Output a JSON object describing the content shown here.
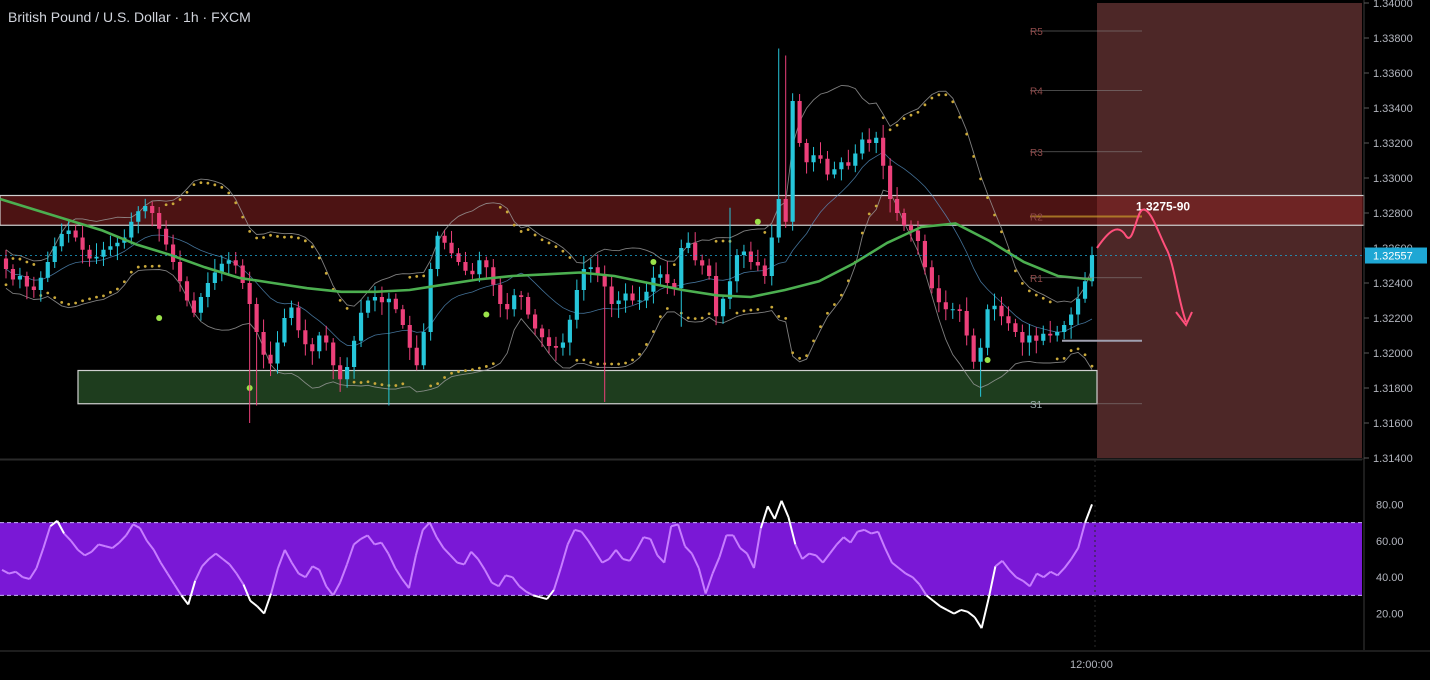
{
  "header": {
    "title": "British Pound / U.S. Dollar · 1h · FXCM"
  },
  "colors": {
    "background": "#000000",
    "candle_up": "#26c6da",
    "candle_down": "#ec407a",
    "sma": "#4caf50",
    "psar": "#c9a83a",
    "bands": "#9e9e9e",
    "resistance_zone": "#8b2323",
    "support_zone": "#2e5e2e",
    "forecast_shade": "#5a2e2e",
    "forecast_arrow": "#ff4f7b",
    "rsi_line": "#b45cff",
    "rsi_band": "#7a18d6",
    "price_tag": "#1ea7d4"
  },
  "chart_data": [
    {
      "type": "candlestick",
      "title": "British Pound / U.S. Dollar · 1h · FXCM",
      "ylim": [
        1.314,
        1.34
      ],
      "y_ticks": [
        "1.31400",
        "1.31600",
        "1.31800",
        "1.32000",
        "1.32200",
        "1.32400",
        "1.32557",
        "1.32600",
        "1.32800",
        "1.33000",
        "1.33200",
        "1.33400",
        "1.33600",
        "1.33800",
        "1.34000"
      ],
      "x_ticks": [
        "12:00:00"
      ],
      "last_price": "1.32557",
      "zones": [
        {
          "name": "resistance",
          "from": 1.3273,
          "to": 1.329
        },
        {
          "name": "support",
          "from": 1.3171,
          "to": 1.319
        }
      ],
      "pivots": [
        {
          "label": "R5",
          "value": 1.3384
        },
        {
          "label": "R4",
          "value": 1.335
        },
        {
          "label": "R3",
          "value": 1.3315
        },
        {
          "label": "R2",
          "value": 1.3278
        },
        {
          "label": "R1",
          "value": 1.3243
        },
        {
          "label": "S1",
          "value": 1.3171
        }
      ],
      "annotation": "1.3275-90",
      "series": [
        {
          "name": "close",
          "values": [
            1.3248,
            1.3242,
            1.3244,
            1.3238,
            1.3236,
            1.3243,
            1.3252,
            1.3261,
            1.3268,
            1.327,
            1.3266,
            1.3259,
            1.3254,
            1.3255,
            1.3259,
            1.3261,
            1.3263,
            1.3266,
            1.3275,
            1.3281,
            1.3284,
            1.328,
            1.3271,
            1.3262,
            1.3252,
            1.3241,
            1.323,
            1.3223,
            1.3232,
            1.324,
            1.3246,
            1.3251,
            1.3253,
            1.325,
            1.324,
            1.3228,
            1.3212,
            1.3199,
            1.3194,
            1.3206,
            1.322,
            1.3226,
            1.3213,
            1.3205,
            1.3201,
            1.321,
            1.3206,
            1.3193,
            1.3185,
            1.3192,
            1.3207,
            1.3223,
            1.323,
            1.3232,
            1.3229,
            1.3231,
            1.3225,
            1.3216,
            1.3203,
            1.3193,
            1.3212,
            1.3248,
            1.3267,
            1.3263,
            1.3257,
            1.3252,
            1.3247,
            1.3245,
            1.3253,
            1.3249,
            1.3239,
            1.3228,
            1.3225,
            1.3233,
            1.3232,
            1.3222,
            1.3214,
            1.3209,
            1.3204,
            1.3203,
            1.3206,
            1.3219,
            1.3236,
            1.3248,
            1.3249,
            1.3245,
            1.3238,
            1.3228,
            1.323,
            1.3234,
            1.323,
            1.323,
            1.3235,
            1.3243,
            1.3245,
            1.324,
            1.3237,
            1.326,
            1.3263,
            1.3253,
            1.325,
            1.3244,
            1.3221,
            1.3231,
            1.3241,
            1.3256,
            1.3258,
            1.3252,
            1.325,
            1.3244,
            1.3266,
            1.3288,
            1.3275,
            1.3344,
            1.332,
            1.3309,
            1.3313,
            1.3311,
            1.3302,
            1.3305,
            1.3309,
            1.3307,
            1.3314,
            1.3322,
            1.332,
            1.3323,
            1.3307,
            1.3288,
            1.328,
            1.3273,
            1.327,
            1.3264,
            1.3249,
            1.3237,
            1.3229,
            1.3225,
            1.3225,
            1.3224,
            1.321,
            1.3195,
            1.3203,
            1.3225,
            1.3227,
            1.3221,
            1.3217,
            1.3212,
            1.3206,
            1.321,
            1.3207,
            1.3211,
            1.321,
            1.3212,
            1.3216,
            1.3222,
            1.3231,
            1.3241,
            1.3256
          ]
        },
        {
          "name": "SMA",
          "values": [
            1.3288,
            1.3282,
            1.3276,
            1.327,
            1.3262,
            1.3256,
            1.3249,
            1.3243,
            1.324,
            1.3237,
            1.3235,
            1.3235,
            1.3236,
            1.3239,
            1.3242,
            1.3244,
            1.3245,
            1.3246,
            1.3244,
            1.324,
            1.3236,
            1.3233,
            1.3232,
            1.3236,
            1.3241,
            1.3251,
            1.3263,
            1.3272,
            1.3274,
            1.3264,
            1.3252,
            1.3244,
            1.3242
          ]
        },
        {
          "name": "RSI",
          "values": [
            44,
            42,
            43,
            40,
            39,
            45,
            56,
            68,
            71,
            64,
            60,
            55,
            52,
            54,
            58,
            57,
            56,
            59,
            63,
            69,
            67,
            60,
            55,
            48,
            42,
            36,
            30,
            25,
            38,
            46,
            50,
            53,
            50,
            47,
            42,
            36,
            27,
            24,
            20,
            31,
            45,
            55,
            48,
            42,
            40,
            46,
            44,
            35,
            30,
            37,
            47,
            58,
            61,
            63,
            58,
            59,
            53,
            45,
            39,
            34,
            52,
            66,
            70,
            62,
            56,
            52,
            48,
            47,
            54,
            50,
            44,
            37,
            35,
            41,
            40,
            35,
            32,
            30,
            29,
            28,
            33,
            45,
            58,
            66,
            65,
            60,
            54,
            48,
            50,
            55,
            50,
            49,
            55,
            62,
            61,
            52,
            48,
            68,
            69,
            57,
            53,
            45,
            31,
            42,
            51,
            63,
            63,
            56,
            53,
            45,
            67,
            79,
            72,
            82,
            73,
            58,
            50,
            53,
            52,
            48,
            53,
            58,
            62,
            59,
            65,
            66,
            64,
            65,
            56,
            48,
            45,
            42,
            40,
            36,
            30,
            27,
            24,
            22,
            20,
            22,
            21,
            18,
            12,
            28,
            46,
            49,
            44,
            40,
            38,
            35,
            42,
            40,
            43,
            41,
            45,
            50,
            56,
            70,
            80
          ]
        }
      ],
      "rsi_panel": {
        "title": "RSI",
        "ylim": [
          0,
          100
        ],
        "band": [
          30,
          70
        ],
        "y_ticks": [
          "20.00",
          "40.00",
          "60.00",
          "80.00"
        ]
      }
    }
  ]
}
